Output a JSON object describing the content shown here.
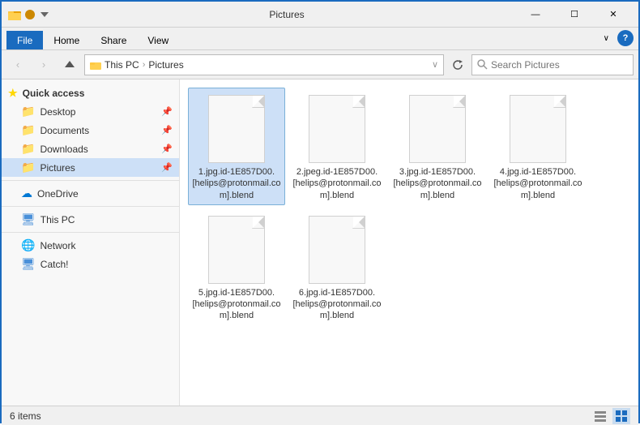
{
  "titleBar": {
    "title": "Pictures",
    "minimizeLabel": "—",
    "maximizeLabel": "☐",
    "closeLabel": "✕"
  },
  "ribbon": {
    "tabs": [
      "File",
      "Home",
      "Share",
      "View"
    ],
    "activeTab": "File",
    "chevronLabel": "∨",
    "helpLabel": "?"
  },
  "nav": {
    "backLabel": "‹",
    "forwardLabel": "›",
    "upLabel": "↑",
    "refreshLabel": "↻",
    "addressDropLabel": "∨",
    "path": [
      "This PC",
      "Pictures"
    ],
    "searchPlaceholder": "Search Pictures"
  },
  "sidebar": {
    "quickAccessLabel": "Quick access",
    "items": [
      {
        "id": "desktop",
        "label": "Desktop",
        "pinned": true,
        "icon": "📁"
      },
      {
        "id": "documents",
        "label": "Documents",
        "pinned": true,
        "icon": "📁"
      },
      {
        "id": "downloads",
        "label": "Downloads",
        "pinned": true,
        "icon": "📁"
      },
      {
        "id": "pictures",
        "label": "Pictures",
        "pinned": true,
        "icon": "📁",
        "active": true
      }
    ],
    "oneDriveLabel": "OneDrive",
    "thisPCLabel": "This PC",
    "networkLabel": "Network",
    "catchLabel": "Catch!"
  },
  "files": [
    {
      "id": "f1",
      "name": "1.jpg.id-1E857D00.[helips@protonmail.com].blend",
      "selected": true
    },
    {
      "id": "f2",
      "name": "2.jpeg.id-1E857D00.[helips@protonmail.com].blend",
      "selected": false
    },
    {
      "id": "f3",
      "name": "3.jpg.id-1E857D00.[helips@protonmail.com].blend",
      "selected": false
    },
    {
      "id": "f4",
      "name": "4.jpg.id-1E857D00.[helips@protonmail.com].blend",
      "selected": false
    },
    {
      "id": "f5",
      "name": "5.jpg.id-1E857D00.[helips@protonmail.com].blend",
      "selected": false
    },
    {
      "id": "f6",
      "name": "6.jpg.id-1E857D00.[helips@protonmail.com].blend",
      "selected": false
    }
  ],
  "statusBar": {
    "itemCount": "6 items"
  }
}
